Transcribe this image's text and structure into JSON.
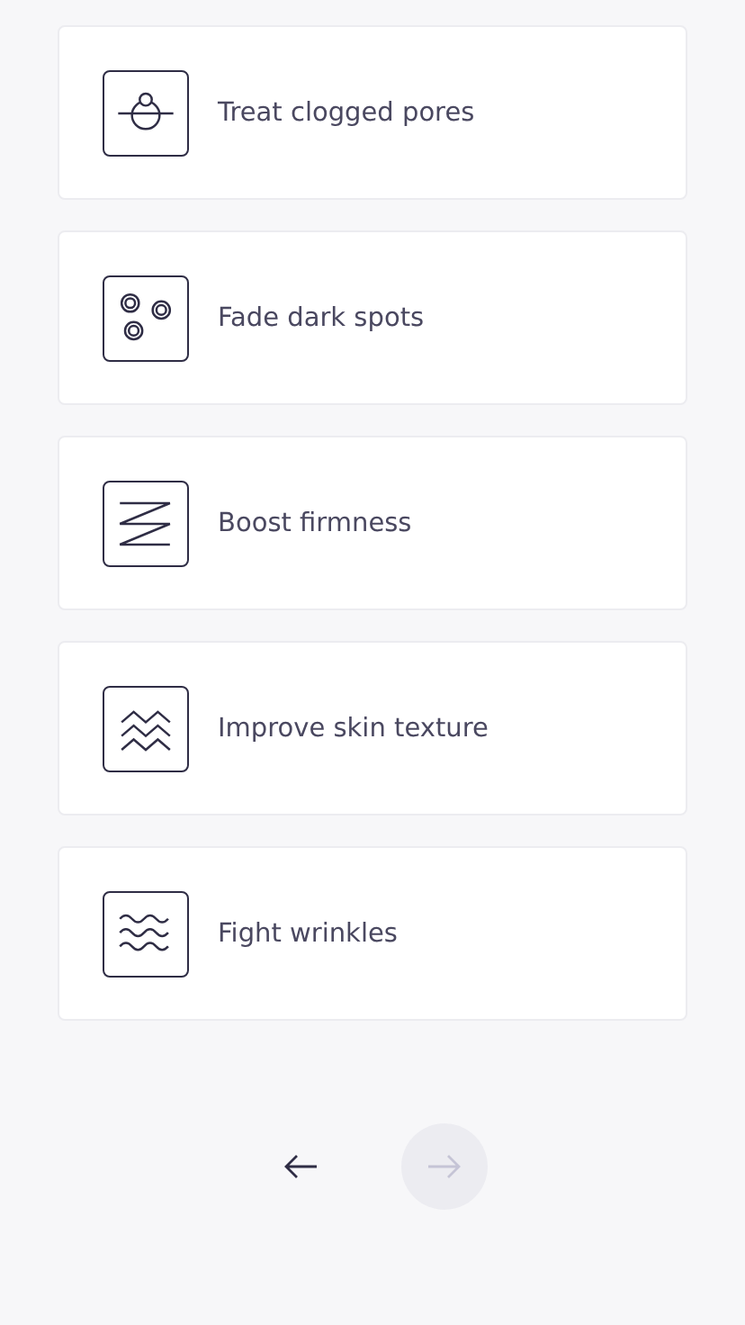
{
  "options": [
    {
      "label": "Treat clogged pores",
      "kind": "pore"
    },
    {
      "label": "Fade dark spots",
      "kind": "spots"
    },
    {
      "label": "Boost firmness",
      "kind": "zigzag"
    },
    {
      "label": "Improve skin texture",
      "kind": "chevrons"
    },
    {
      "label": "Fight wrinkles",
      "kind": "waves"
    }
  ],
  "navigation": {
    "back": {
      "disabled": false
    },
    "next": {
      "disabled": true
    }
  }
}
